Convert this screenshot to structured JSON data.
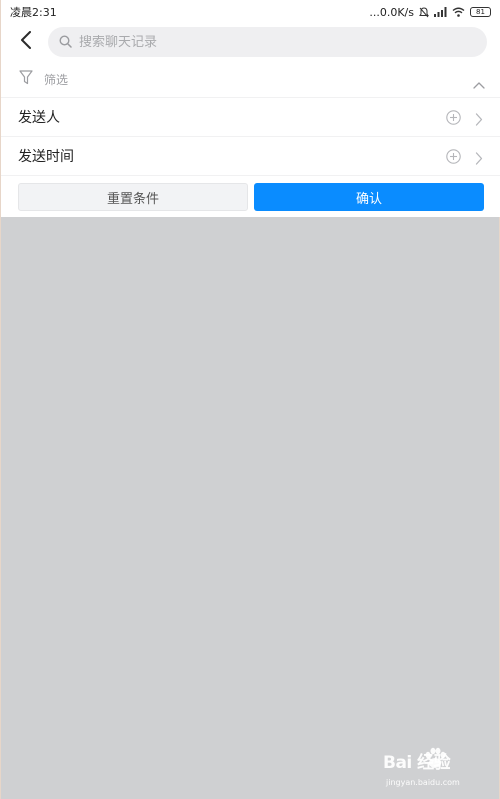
{
  "status_bar": {
    "time": "凌晨2:31",
    "network_speed": "...0.0K/s",
    "battery": "81"
  },
  "header": {
    "back_icon": "chevron-left-icon",
    "search_placeholder": "搜索聊天记录",
    "search_value": ""
  },
  "filter": {
    "title": "筛选",
    "rows": [
      {
        "label": "发送人"
      },
      {
        "label": "发送时间"
      }
    ],
    "reset_label": "重置条件",
    "confirm_label": "确认"
  },
  "watermark": {
    "brand": "Bai 经验",
    "url": "jingyan.baidu.com"
  },
  "colors": {
    "accent": "#0a8cff",
    "overlay": "#cfd0d2",
    "search_bg": "#efeff1"
  }
}
